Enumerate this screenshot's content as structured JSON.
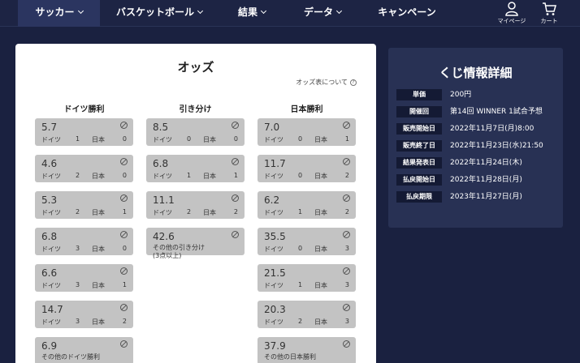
{
  "nav": {
    "items": [
      {
        "label": "サッカー",
        "active": true
      },
      {
        "label": "バスケットボール"
      },
      {
        "label": "結果"
      },
      {
        "label": "データ"
      },
      {
        "label": "キャンペーン"
      }
    ],
    "mypage_label": "マイページ",
    "cart_label": "カート"
  },
  "odds": {
    "title": "オッズ",
    "note": "オッズ表について",
    "columns": [
      {
        "header": "ドイツ勝利",
        "cells": [
          {
            "odds": "5.7",
            "team1": "ドイツ",
            "score1": "1",
            "team2": "日本",
            "score2": "0"
          },
          {
            "odds": "4.6",
            "team1": "ドイツ",
            "score1": "2",
            "team2": "日本",
            "score2": "0"
          },
          {
            "odds": "5.3",
            "team1": "ドイツ",
            "score1": "2",
            "team2": "日本",
            "score2": "1"
          },
          {
            "odds": "6.8",
            "team1": "ドイツ",
            "score1": "3",
            "team2": "日本",
            "score2": "0"
          },
          {
            "odds": "6.6",
            "team1": "ドイツ",
            "score1": "3",
            "team2": "日本",
            "score2": "1"
          },
          {
            "odds": "14.7",
            "team1": "ドイツ",
            "score1": "3",
            "team2": "日本",
            "score2": "2"
          },
          {
            "odds": "6.9",
            "other": "その他のドイツ勝利"
          }
        ]
      },
      {
        "header": "引き分け",
        "cells": [
          {
            "odds": "8.5",
            "team1": "ドイツ",
            "score1": "0",
            "team2": "日本",
            "score2": "0"
          },
          {
            "odds": "6.8",
            "team1": "ドイツ",
            "score1": "1",
            "team2": "日本",
            "score2": "1"
          },
          {
            "odds": "11.1",
            "team1": "ドイツ",
            "score1": "2",
            "team2": "日本",
            "score2": "2"
          },
          {
            "odds": "42.6",
            "other": "その他の引き分け\n(3点以上)"
          }
        ]
      },
      {
        "header": "日本勝利",
        "cells": [
          {
            "odds": "7.0",
            "team1": "ドイツ",
            "score1": "0",
            "team2": "日本",
            "score2": "1"
          },
          {
            "odds": "11.7",
            "team1": "ドイツ",
            "score1": "0",
            "team2": "日本",
            "score2": "2"
          },
          {
            "odds": "6.2",
            "team1": "ドイツ",
            "score1": "1",
            "team2": "日本",
            "score2": "2"
          },
          {
            "odds": "35.5",
            "team1": "ドイツ",
            "score1": "0",
            "team2": "日本",
            "score2": "3"
          },
          {
            "odds": "21.5",
            "team1": "ドイツ",
            "score1": "1",
            "team2": "日本",
            "score2": "3"
          },
          {
            "odds": "20.3",
            "team1": "ドイツ",
            "score1": "2",
            "team2": "日本",
            "score2": "3"
          },
          {
            "odds": "37.9",
            "other": "その他の日本勝利"
          }
        ]
      }
    ]
  },
  "detail": {
    "title": "くじ情報詳細",
    "rows": [
      {
        "label": "単価",
        "value": "200円"
      },
      {
        "label": "開催回",
        "value": "第14回 WINNER 1試合予想"
      },
      {
        "label": "販売開始日",
        "value": "2022年11月7日(月)8:00"
      },
      {
        "label": "販売終了日",
        "value": "2022年11月23日(水)21:50"
      },
      {
        "label": "結果発表日",
        "value": "2022年11月24日(木)"
      },
      {
        "label": "払戻開始日",
        "value": "2022年11月28日(月)"
      },
      {
        "label": "払戻期限",
        "value": "2023年11月27日(月)"
      }
    ]
  },
  "colors": {
    "background": "#1a2140",
    "panel": "#283154",
    "cell": "#c3c3c3"
  }
}
